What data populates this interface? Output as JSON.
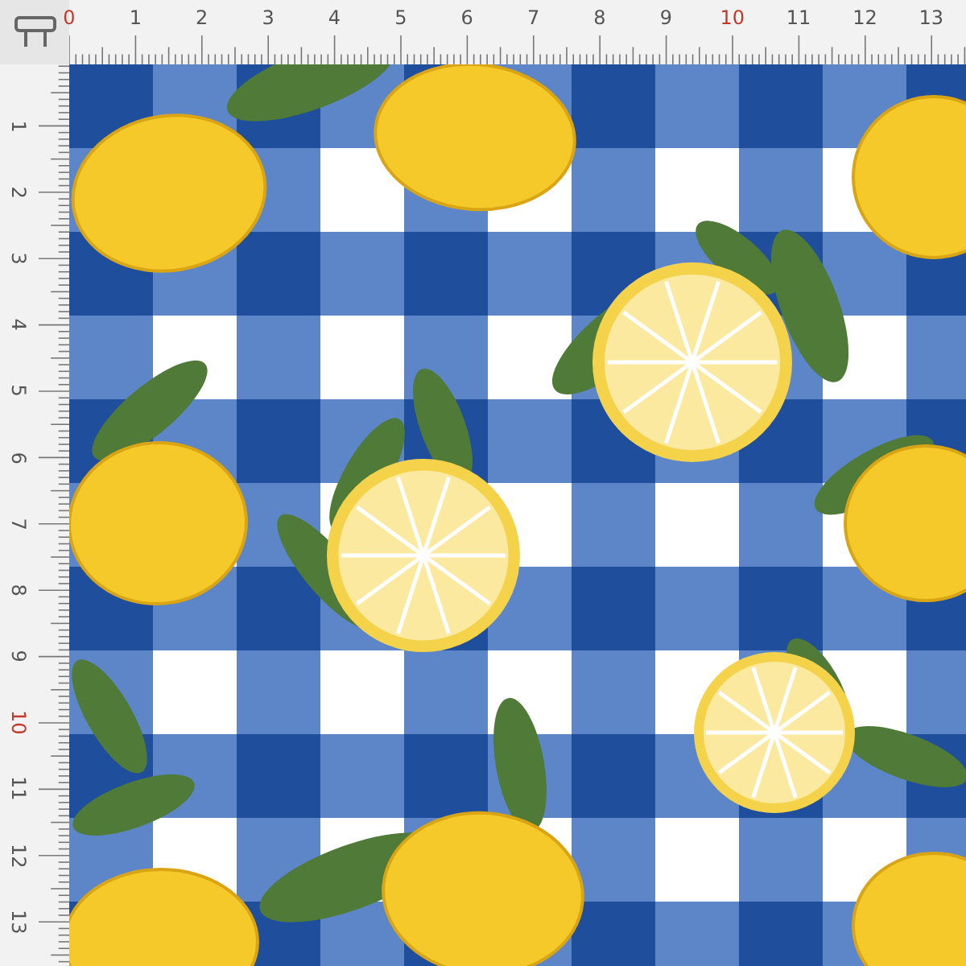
{
  "top_ruler": {
    "labels": [
      {
        "text": "0",
        "highlight": true
      },
      {
        "text": "1",
        "highlight": false
      },
      {
        "text": "2",
        "highlight": false
      },
      {
        "text": "3",
        "highlight": false
      },
      {
        "text": "4",
        "highlight": false
      },
      {
        "text": "5",
        "highlight": false
      },
      {
        "text": "6",
        "highlight": false
      },
      {
        "text": "7",
        "highlight": false
      },
      {
        "text": "8",
        "highlight": false
      },
      {
        "text": "9",
        "highlight": false
      },
      {
        "text": "10",
        "highlight": true
      },
      {
        "text": "11",
        "highlight": false
      },
      {
        "text": "12",
        "highlight": false
      },
      {
        "text": "13",
        "highlight": false
      }
    ]
  },
  "left_ruler": {
    "labels": [
      {
        "text": "1",
        "highlight": false
      },
      {
        "text": "2",
        "highlight": false
      },
      {
        "text": "3",
        "highlight": false
      },
      {
        "text": "4",
        "highlight": false
      },
      {
        "text": "5",
        "highlight": false
      },
      {
        "text": "6",
        "highlight": false
      },
      {
        "text": "7",
        "highlight": false
      },
      {
        "text": "8",
        "highlight": false
      },
      {
        "text": "9",
        "highlight": false
      },
      {
        "text": "10",
        "highlight": true
      },
      {
        "text": "11",
        "highlight": false
      },
      {
        "text": "12",
        "highlight": false
      },
      {
        "text": "13",
        "highlight": false
      }
    ]
  }
}
